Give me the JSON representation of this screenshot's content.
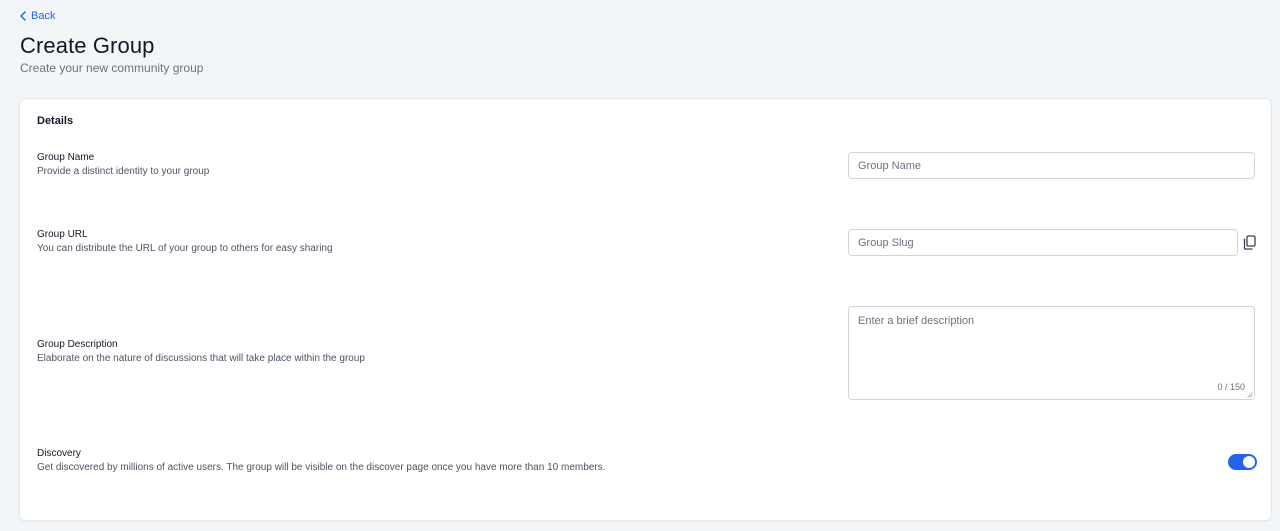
{
  "nav": {
    "back_label": "Back"
  },
  "header": {
    "title": "Create Group",
    "subtitle": "Create your new community group"
  },
  "details": {
    "section_title": "Details",
    "group_name": {
      "label": "Group Name",
      "help": "Provide a distinct identity to your group",
      "value": "",
      "placeholder": "Group Name"
    },
    "group_url": {
      "label": "Group URL",
      "help": "You can distribute the URL of your group to others for easy sharing",
      "value": "",
      "placeholder": "Group Slug",
      "copy_icon": "copy-icon"
    },
    "group_description": {
      "label": "Group Description",
      "help": "Elaborate on the nature of discussions that will take place within the group",
      "value": "",
      "placeholder": "Enter a brief description",
      "char_count": "0 / 150"
    },
    "discovery": {
      "label": "Discovery",
      "help": "Get discovered by millions of active users. The group will be visible on the discover page once you have more than 10 members.",
      "enabled": true
    }
  },
  "colors": {
    "accent": "#2563eb",
    "background": "#f3f6f9",
    "card": "#ffffff"
  }
}
